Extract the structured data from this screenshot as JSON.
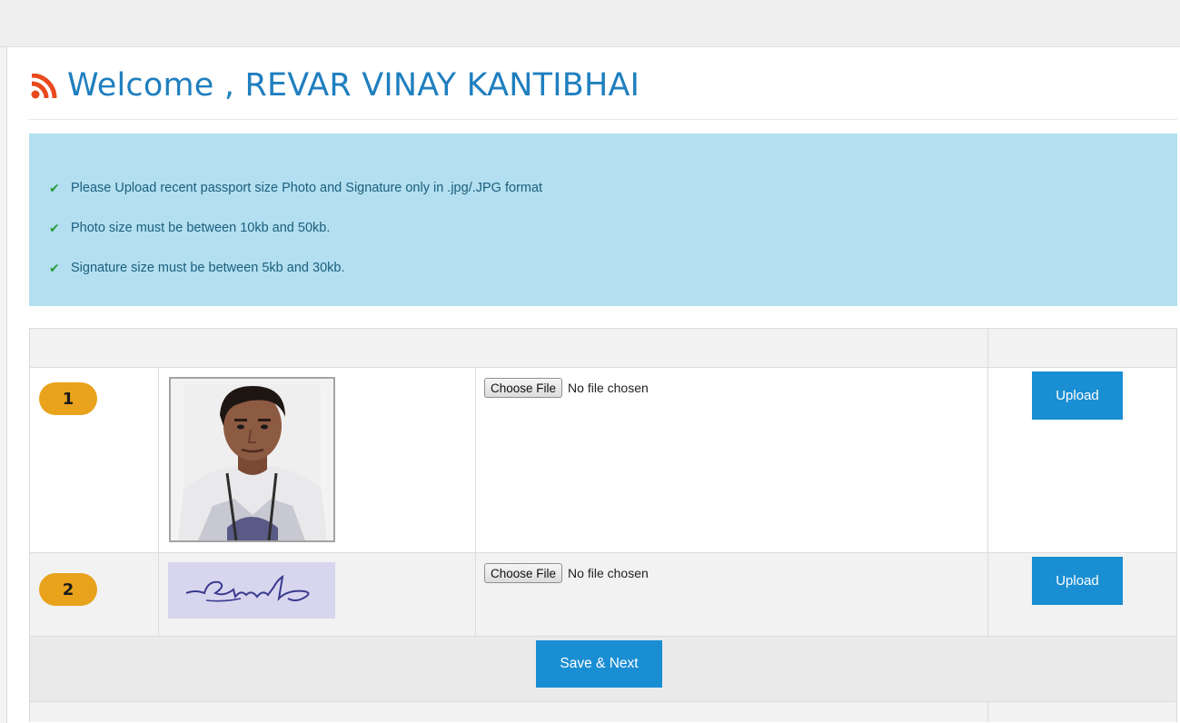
{
  "header": {
    "title": "Welcome , REVAR VINAY KANTIBHAI",
    "icon": "rss-icon",
    "title_color": "#1f7fbf",
    "icon_color": "#e8491d"
  },
  "instructions": {
    "background": "#b3dff0",
    "items": [
      "Please Upload recent passport size  Photo and Signature only in .jpg/.JPG format",
      "Photo size must be between 10kb and 50kb.",
      "Signature size must be between 5kb and 30kb."
    ],
    "bullet_icon": "check-icon"
  },
  "uploads": {
    "rows": [
      {
        "number": "1",
        "type": "photo",
        "choose_label": "Choose File",
        "file_status": "No file chosen",
        "upload_label": "Upload"
      },
      {
        "number": "2",
        "type": "signature",
        "choose_label": "Choose File",
        "file_status": "No file chosen",
        "upload_label": "Upload"
      }
    ],
    "badge_color": "#e8a21b",
    "button_color": "#1a8ed3"
  },
  "footer": {
    "save_label": "Save & Next"
  }
}
